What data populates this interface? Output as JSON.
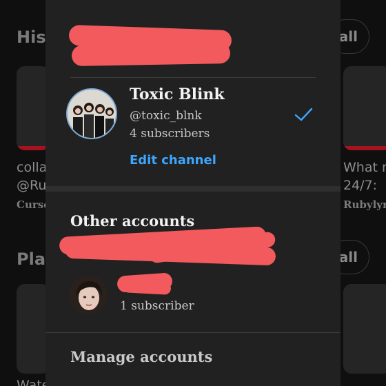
{
  "background": {
    "history_title": "Hist",
    "history_view_all": "all",
    "playlists_title": "Play",
    "playlists_view_all": "all",
    "left_item_line1": "colla",
    "left_item_line2": "@Ru",
    "left_item_channel": "Curse",
    "right_item_line1": "What m",
    "right_item_line2": "24/7:",
    "right_item_channel": "Rubylyr",
    "bottom_left_text": "Wate"
  },
  "current_account": {
    "channel_name": "Toxic Blink",
    "handle": "@toxic_blnk",
    "subscribers": "4 subscribers",
    "edit_label": "Edit channel",
    "selected_icon": "checkmark-icon"
  },
  "other_accounts": {
    "section_title": "Other accounts",
    "items": [
      {
        "subscribers": "1 subscriber"
      }
    ]
  },
  "manage_label": "Manage accounts",
  "colors": {
    "accent_blue": "#3ea6ff",
    "redaction": "#f25a5e",
    "sheet_background": "#212121",
    "page_background": "#0f0f0f"
  }
}
